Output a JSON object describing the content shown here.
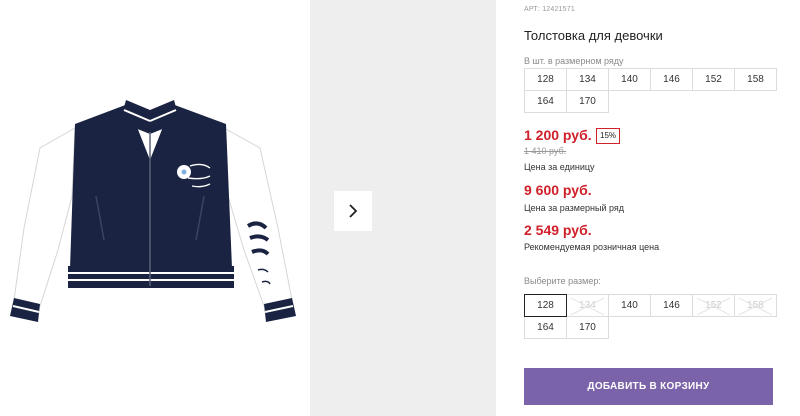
{
  "product": {
    "sku": "АРТ: 12421571",
    "title": "Толстовка для девочки"
  },
  "sizes_in_row": {
    "label": "В шт. в размерном ряду",
    "sizes": [
      "128",
      "134",
      "140",
      "146",
      "152",
      "158",
      "164",
      "170"
    ]
  },
  "prices": {
    "unit_price": "1 200 руб.",
    "discount": "15%",
    "old_price": "1 410 руб.",
    "unit_caption": "Цена за единицу",
    "row_price": "9 600 руб.",
    "row_caption": "Цена за размерный ряд",
    "retail_price": "2 549 руб.",
    "retail_caption": "Рекомендуемая розничная цена"
  },
  "size_picker": {
    "label": "Выберите размер:",
    "options": [
      {
        "size": "128",
        "available": true,
        "selected": true
      },
      {
        "size": "134",
        "available": false,
        "selected": false
      },
      {
        "size": "140",
        "available": true,
        "selected": false
      },
      {
        "size": "146",
        "available": true,
        "selected": false
      },
      {
        "size": "152",
        "available": false,
        "selected": false
      },
      {
        "size": "158",
        "available": false,
        "selected": false
      },
      {
        "size": "164",
        "available": true,
        "selected": false
      },
      {
        "size": "170",
        "available": true,
        "selected": false
      }
    ]
  },
  "actions": {
    "add_to_cart": "ДОБАВИТЬ В КОРЗИНУ"
  },
  "gallery": {
    "next_icon": "chevron-right-icon",
    "jacket_body_color": "#1a2341",
    "jacket_sleeve_color": "#ffffff"
  },
  "colors": {
    "accent_button": "#7a63a8",
    "price_red": "#d0202a"
  }
}
